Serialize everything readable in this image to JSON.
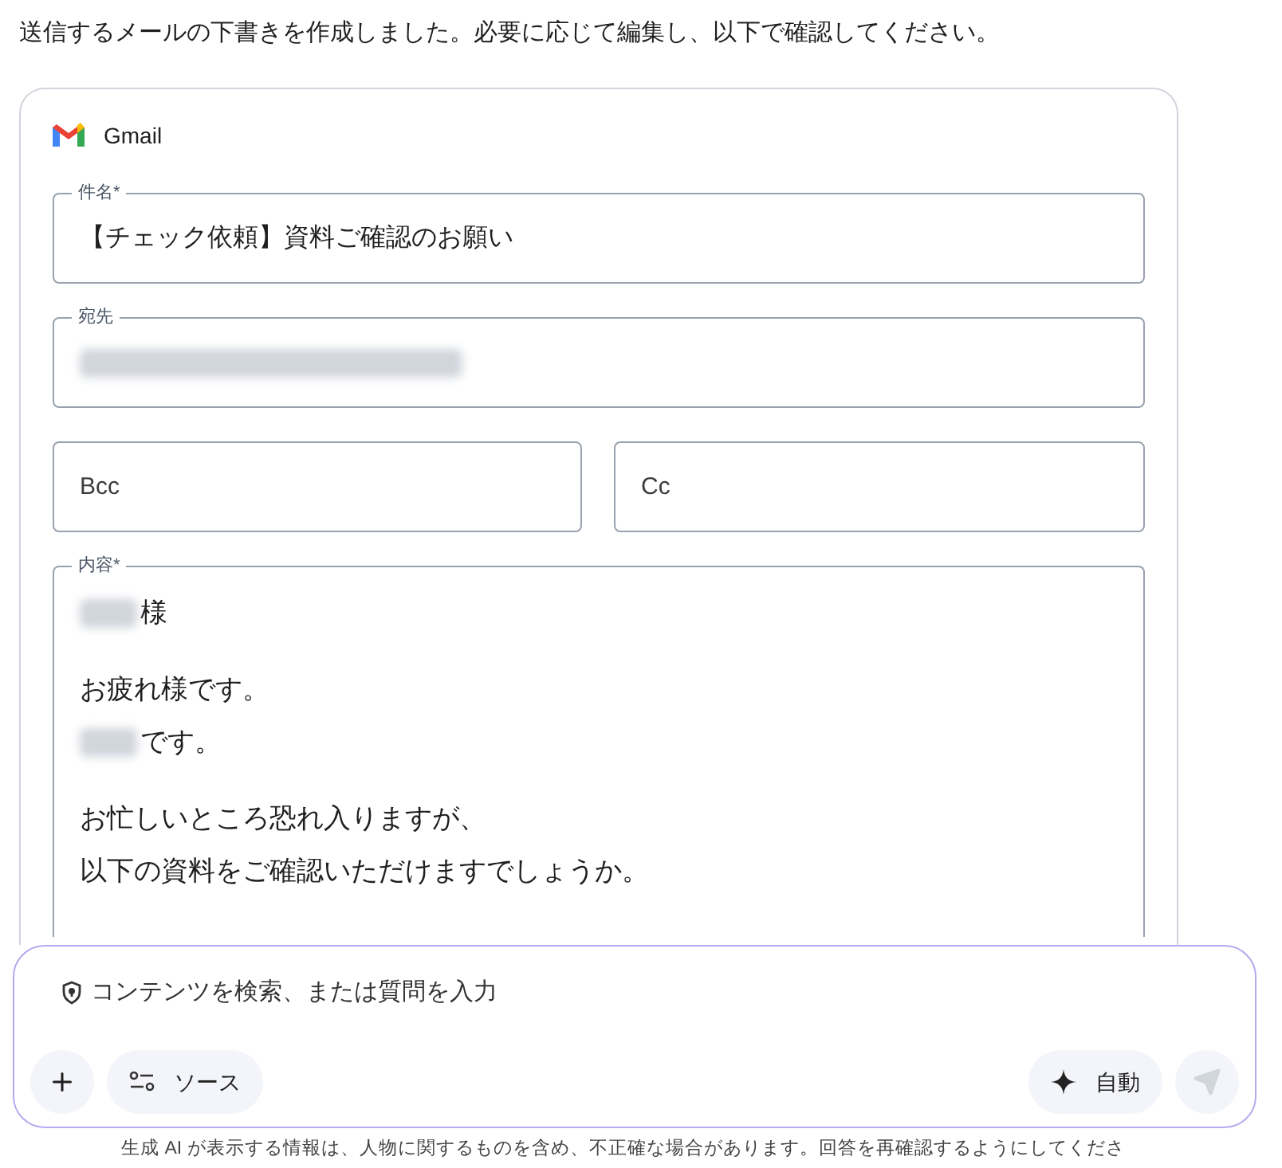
{
  "intro": "送信するメールの下書きを作成しました。必要に応じて編集し、以下で確認してください。",
  "card": {
    "app_name": "Gmail",
    "subject": {
      "label": "件名*",
      "value": "【チェック依頼】資料ご確認のお願い"
    },
    "recipient": {
      "label": "宛先",
      "redacted": true
    },
    "bcc": {
      "placeholder": "Bcc"
    },
    "cc": {
      "placeholder": "Cc"
    },
    "body": {
      "label": "内容*",
      "paragraphs": [
        [
          {
            "kind": "redacted_prefix",
            "text": "様"
          }
        ],
        [
          {
            "kind": "plain",
            "text": "お疲れ様です。"
          },
          {
            "kind": "redacted_prefix",
            "text": "です。"
          }
        ],
        [
          {
            "kind": "plain",
            "text": "お忙しいところ恐れ入りますが、"
          },
          {
            "kind": "plain",
            "text": "以下の資料をご確認いただけますでしょうか。"
          }
        ]
      ]
    }
  },
  "prompt": {
    "placeholder": "コンテンツを検索、または質問を入力",
    "source_label": "ソース",
    "mode_label": "自動",
    "send_disabled": true
  },
  "disclaimer": "生成 AI が表示する情報は、人物に関するものを含め、不正確な場合があります。回答を再確認するようにしてくださ"
}
